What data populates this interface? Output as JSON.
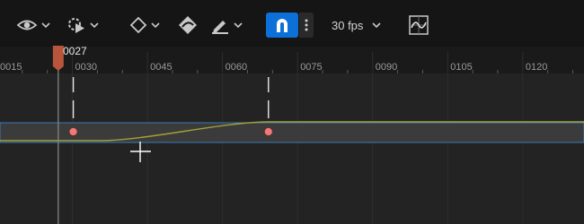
{
  "toolbar": {
    "view_icon": "eye-icon",
    "playback_icon": "gear-play-icon",
    "key_icon": "diamond-icon",
    "interp_icon": "curve-key-icon",
    "draw_icon": "pencil-icon",
    "snap_icon": "magnet-icon",
    "more_icon": "vertical-dots-icon",
    "fps_label": "30 fps",
    "curve_editor_icon": "curve-editor-icon"
  },
  "playhead": {
    "frame_label": "0027",
    "frame": 27
  },
  "ruler": {
    "tick_labels": [
      "0015",
      "0030",
      "0045",
      "0060",
      "0075",
      "0090",
      "0105",
      "0120"
    ]
  },
  "track": {
    "keyframes": [
      30,
      69
    ],
    "curve_color": "#a2a13a",
    "track_border_color": "#3a7ab8",
    "key_color": "#f07a7a"
  },
  "colors": {
    "accent": "#0d6fd8",
    "playhead": "#b8553b"
  }
}
